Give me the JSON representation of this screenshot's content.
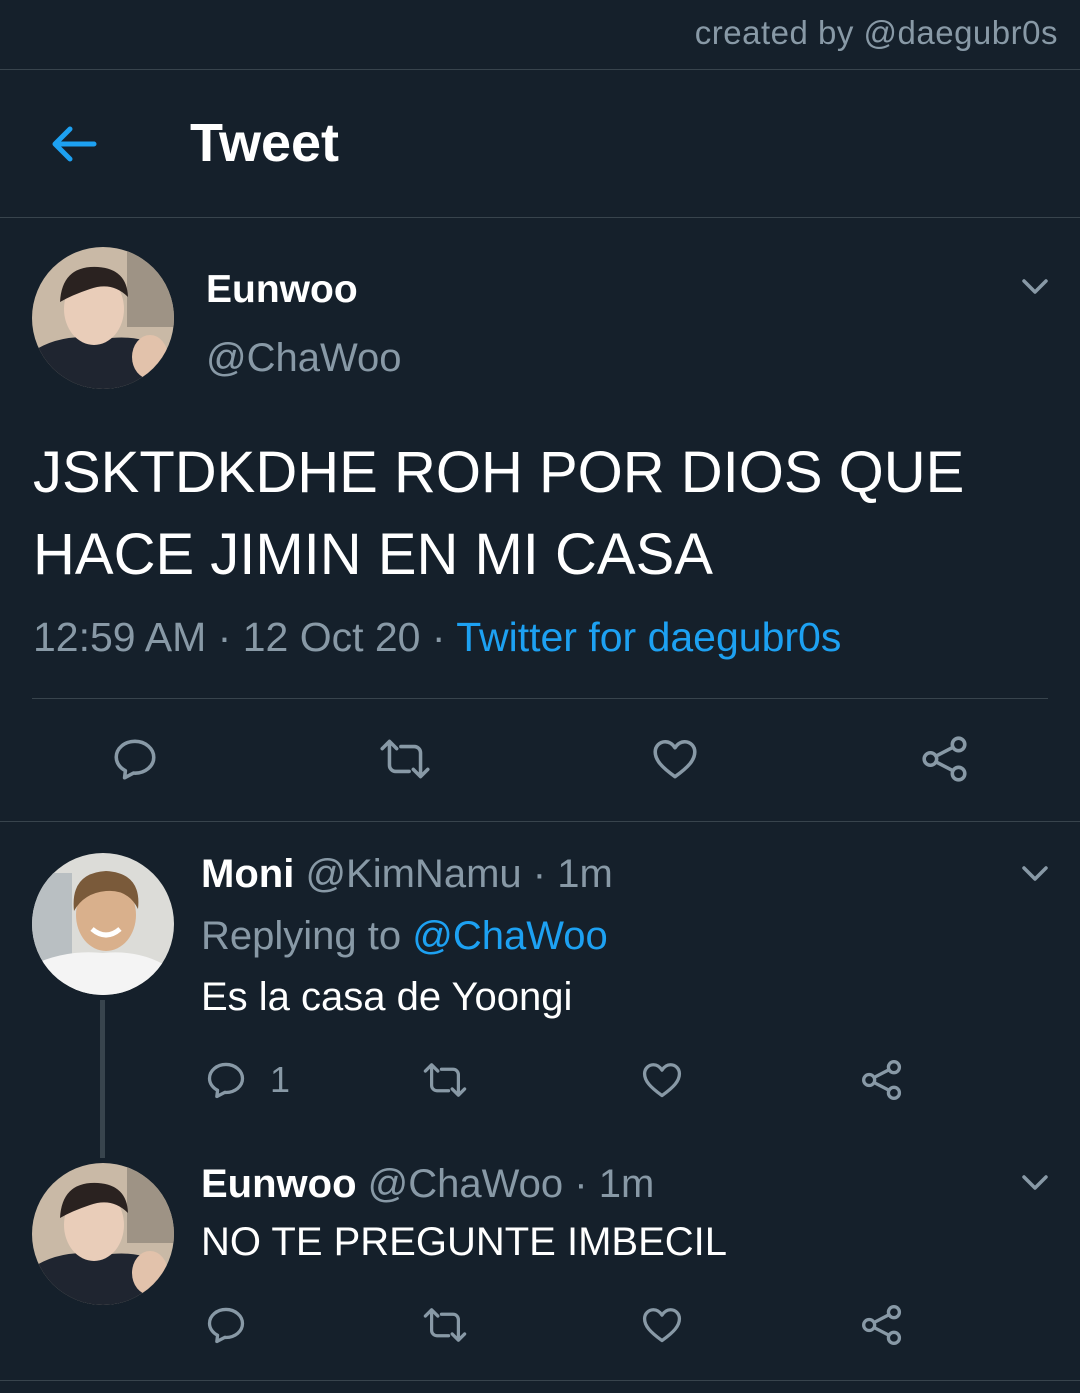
{
  "watermark": "created by @daegubr0s",
  "header": {
    "title": "Tweet",
    "back_icon": "arrow-left-icon",
    "accent": "#1da1f2"
  },
  "tweet": {
    "name": "Eunwoo",
    "handle": "@ChaWoo",
    "text": "JSKTDKDHE ROH POR DIOS QUE HACE JIMIN EN MI CASA",
    "time": "12:59 AM",
    "sep": "·",
    "date": "12 Oct 20",
    "source": "Twitter for daegubr0s",
    "actions": [
      "reply-icon",
      "retweet-icon",
      "like-icon",
      "share-icon"
    ]
  },
  "reply1": {
    "name": "Moni",
    "handle": "@KimNamu",
    "sep": "·",
    "time": "1m",
    "replying_label": "Replying to",
    "replying_handle": "@ChaWoo",
    "text": "Es la casa de Yoongi",
    "reply_count": "1"
  },
  "reply2": {
    "name": "Eunwoo",
    "handle": "@ChaWoo",
    "sep": "·",
    "time": "1m",
    "text": "NO TE PREGUNTE IMBECIL"
  },
  "colors": {
    "background": "#15202b",
    "muted": "#8899a6",
    "divider": "#38444d",
    "link": "#1da1f2"
  }
}
